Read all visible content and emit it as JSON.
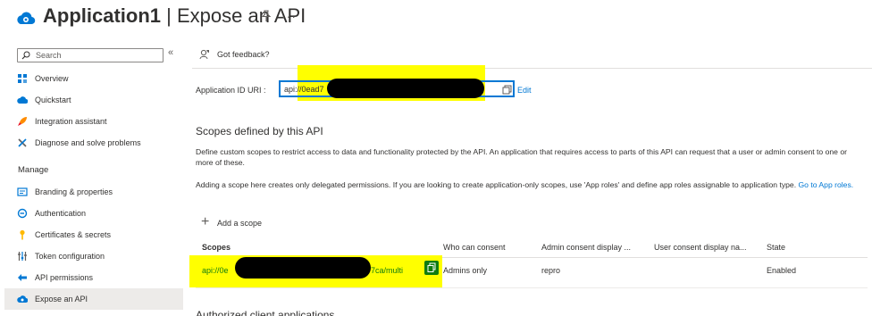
{
  "header": {
    "app_name": "Application1",
    "separator": " | ",
    "page_name": "Expose an API",
    "more": "···"
  },
  "sidebar": {
    "search_placeholder": "Search",
    "collapse": "«",
    "section_label": "Manage",
    "items": [
      {
        "label": "Overview",
        "icon": "grid-icon"
      },
      {
        "label": "Quickstart",
        "icon": "cloud-icon"
      },
      {
        "label": "Integration assistant",
        "icon": "rocket-icon"
      },
      {
        "label": "Diagnose and solve problems",
        "icon": "wrench-icon"
      },
      {
        "label": "Branding & properties",
        "icon": "branding-icon"
      },
      {
        "label": "Authentication",
        "icon": "authentication-icon"
      },
      {
        "label": "Certificates & secrets",
        "icon": "key-icon"
      },
      {
        "label": "Token configuration",
        "icon": "sliders-icon"
      },
      {
        "label": "API permissions",
        "icon": "permissions-icon"
      },
      {
        "label": "Expose an API",
        "icon": "cloud-icon"
      }
    ],
    "active_item": "Expose an API"
  },
  "toolbar": {
    "feedback_label": "Got feedback?"
  },
  "application_id": {
    "label": "Application ID URI :",
    "value_prefix": "api://0ead7",
    "edit_label": "Edit"
  },
  "scopes_section": {
    "title": "Scopes defined by this API",
    "description_1": "Define custom scopes to restrict access to data and functionality protected by the API. An application that requires access to parts of this API can request that a user or admin consent to one or more of these.",
    "description_2_text": "Adding a scope here creates only delegated permissions. If you are looking to create application-only scopes, use 'App roles' and define app roles assignable to application type.",
    "description_2_link": "Go to App roles.",
    "add_scope_label": "Add a scope"
  },
  "scopes_table": {
    "columns": [
      "Scopes",
      "Who can consent",
      "Admin consent display ...",
      "User consent display na...",
      "State"
    ],
    "rows": [
      {
        "scope_prefix": "api://0e",
        "scope_suffix": "7ca/multi",
        "who_can_consent": "Admins only",
        "admin_consent_display": "repro",
        "user_consent_display": "",
        "state": "Enabled"
      }
    ]
  },
  "next_section": {
    "title": "Authorized client applications"
  },
  "colors": {
    "accent": "#0078d4",
    "highlight": "#ffff00",
    "scope_green": "#107c10",
    "redaction": "#000000"
  }
}
